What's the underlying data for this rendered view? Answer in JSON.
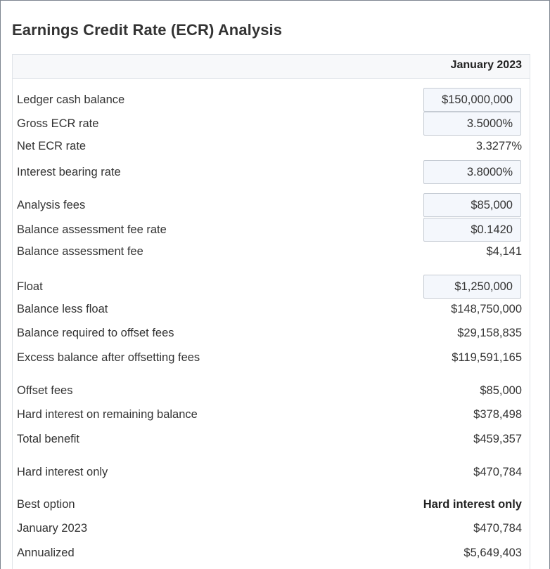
{
  "page_title": "Earnings Credit Rate (ECR) Analysis",
  "column_header": "January 2023",
  "rows": {
    "ledger_cash_balance": {
      "label": "Ledger cash balance",
      "value": "$150,000,000"
    },
    "gross_ecr_rate": {
      "label": "Gross ECR rate",
      "value": "3.5000%"
    },
    "net_ecr_rate": {
      "label": "Net ECR rate",
      "value": "3.3277%"
    },
    "interest_bearing_rate": {
      "label": "Interest bearing rate",
      "value": "3.8000%"
    },
    "analysis_fees": {
      "label": "Analysis fees",
      "value": "$85,000"
    },
    "balance_assessment_fee_rate": {
      "label": "Balance assessment fee rate",
      "value": "$0.1420"
    },
    "balance_assessment_fee": {
      "label": "Balance assessment fee",
      "value": "$4,141"
    },
    "float": {
      "label": "Float",
      "value": "$1,250,000"
    },
    "balance_less_float": {
      "label": "Balance less float",
      "value": "$148,750,000"
    },
    "balance_required_to_offset_fees": {
      "label": "Balance required to offset fees",
      "value": "$29,158,835"
    },
    "excess_balance_after_offsetting_fees": {
      "label": "Excess balance after offsetting fees",
      "value": "$119,591,165"
    },
    "offset_fees": {
      "label": "Offset fees",
      "value": "$85,000"
    },
    "hard_interest_on_remaining_balance": {
      "label": "Hard interest on remaining balance",
      "value": "$378,498"
    },
    "total_benefit": {
      "label": "Total benefit",
      "value": "$459,357"
    },
    "hard_interest_only": {
      "label": "Hard interest only",
      "value": "$470,784"
    },
    "best_option": {
      "label": "Best option",
      "value": "Hard interest only"
    },
    "january_2023": {
      "label": "January 2023",
      "value": "$470,784"
    },
    "annualized": {
      "label": "Annualized",
      "value": "$5,649,403"
    }
  }
}
